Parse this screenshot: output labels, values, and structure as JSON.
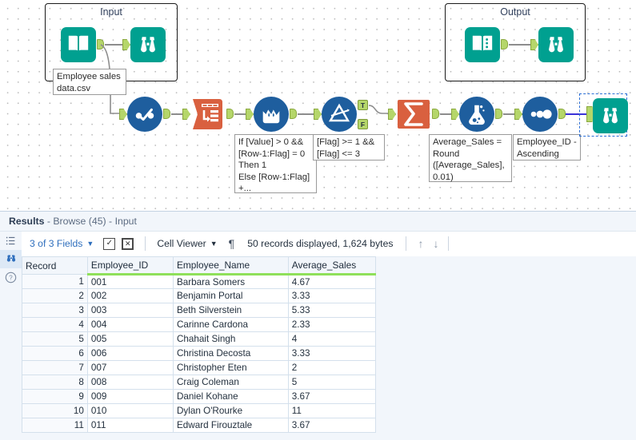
{
  "canvas": {
    "containers": [
      {
        "title": "Input"
      },
      {
        "title": "Output"
      }
    ],
    "annotations": [
      {
        "text": "If [Value] > 0 &&\n[Row-1:Flag] = 0\nThen 1\nElse [Row-1:Flag]\n+..."
      },
      {
        "text": "[Flag] >= 1 &&\n[Flag] <= 3"
      },
      {
        "text": "Average_Sales =\nRound\n([Average_Sales],\n0.01)"
      },
      {
        "text": "Employee_ID -\nAscending"
      },
      {
        "text": "Employee sales\ndata.csv"
      }
    ],
    "tools": [
      {
        "name": "input-data-tool",
        "icon": "book-icon"
      },
      {
        "name": "browse-tool-input",
        "icon": "binoculars-icon"
      },
      {
        "name": "output-data-tool",
        "icon": "book-icon"
      },
      {
        "name": "browse-tool-output",
        "icon": "binoculars-icon"
      },
      {
        "name": "select-tool",
        "icon": "select-icon"
      },
      {
        "name": "multi-row-formula-tool",
        "icon": "multi-row-formula-icon"
      },
      {
        "name": "data-cleansing-tool",
        "icon": "cleanse-icon"
      },
      {
        "name": "filter-tool",
        "icon": "filter-icon"
      },
      {
        "name": "summarize-tool",
        "icon": "sigma-icon"
      },
      {
        "name": "formula-tool",
        "icon": "flask-icon"
      },
      {
        "name": "sort-tool",
        "icon": "sort-icon"
      },
      {
        "name": "browse-tool-final",
        "icon": "binoculars-icon"
      }
    ],
    "filter_outputs": {
      "true_label": "T",
      "false_label": "F"
    },
    "colors": {
      "teal": "#00A090",
      "blue": "#1E5E9E",
      "orange": "#D9603F",
      "anchor_green": "#B5D66A",
      "selected_wire": "#3A31D8"
    }
  },
  "results": {
    "title_bold": "Results",
    "title_rest": " - Browse (45) - Input",
    "rail": [
      {
        "name": "list-view-icon"
      },
      {
        "name": "browse-icon"
      },
      {
        "name": "help-icon"
      }
    ],
    "toolbar": {
      "fields_label": "3 of 3 Fields",
      "select_all_label": "✓",
      "deselect_all_label": "☒",
      "viewer_label": "Cell Viewer",
      "pilcrow_label": "¶",
      "record_status": "50 records displayed, 1,624 bytes",
      "up_arrow": "↑",
      "down_arrow": "↓"
    },
    "table": {
      "columns": [
        "Record",
        "Employee_ID",
        "Employee_Name",
        "Average_Sales"
      ],
      "rows": [
        [
          "1",
          "001",
          "Barbara Somers",
          "4.67"
        ],
        [
          "2",
          "002",
          "Benjamin Portal",
          "3.33"
        ],
        [
          "3",
          "003",
          "Beth Silverstein",
          "5.33"
        ],
        [
          "4",
          "004",
          "Carinne Cardona",
          "2.33"
        ],
        [
          "5",
          "005",
          "Chahait Singh",
          "4"
        ],
        [
          "6",
          "006",
          "Christina Decosta",
          "3.33"
        ],
        [
          "7",
          "007",
          "Christopher Eten",
          "2"
        ],
        [
          "8",
          "008",
          "Craig Coleman",
          "5"
        ],
        [
          "9",
          "009",
          "Daniel Kohane",
          "3.67"
        ],
        [
          "10",
          "010",
          "Dylan O'Rourke",
          "11"
        ],
        [
          "11",
          "011",
          "Edward Firouztale",
          "3.67"
        ]
      ]
    }
  }
}
